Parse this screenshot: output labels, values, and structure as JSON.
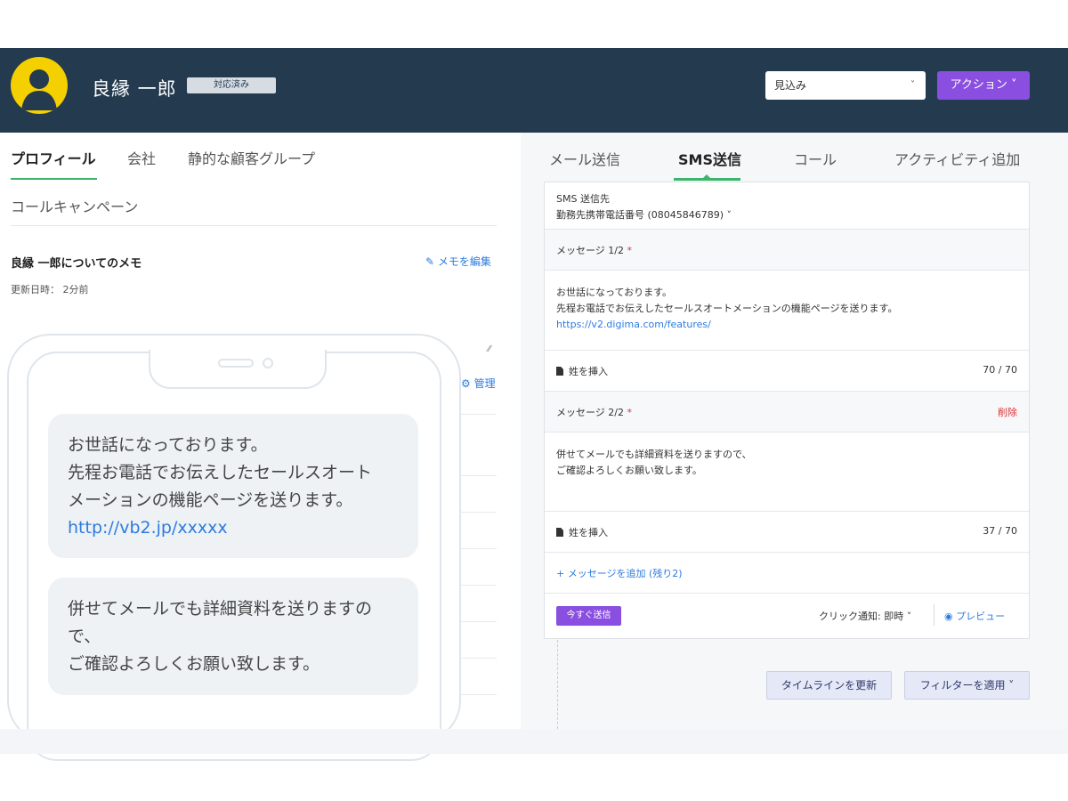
{
  "header": {
    "contact_name": "良縁 一郎",
    "status_badge": "対応済み",
    "stage_select": {
      "selected": "見込み",
      "chevron": "˅"
    },
    "action_button": "アクション ˅",
    "avatar_icon": "user-silhouette",
    "colors": {
      "background": "#243a4f",
      "avatar": "#f4d000",
      "action": "#8a4fe0"
    }
  },
  "left": {
    "tabs": [
      "プロフィール",
      "会社",
      "静的な顧客グループ"
    ],
    "tab_row2": "コールキャンペーン",
    "memo": {
      "title": "良縁 一郎についてのメモ",
      "edit_link": "✎ メモを編集",
      "updated": "更新日時： 2分前"
    },
    "manage_link": "⚙ 管理",
    "resize_mark": "⁄⁄"
  },
  "phone": {
    "bubble1": {
      "line1": "お世話になっております。",
      "line2": "先程お電話でお伝えしたセールスオート",
      "line3": "メーションの機能ページを送ります。",
      "link": "http://vb2.jp/xxxxx"
    },
    "bubble2": {
      "line1": "併せてメールでも詳細資料を送りますの",
      "line2": "で、",
      "line3": "ご確認よろしくお願い致します。"
    }
  },
  "right": {
    "tabs": [
      "メール送信",
      "SMS送信",
      "コール",
      "アクティビティ追加"
    ],
    "sms": {
      "to_label": "SMS 送信先",
      "to_value": "勤務先携帯電話番号 (08045846789)  ˅",
      "message1": {
        "label": "メッセージ 1/2",
        "required_mark": "*",
        "line1": "お世話になっております。",
        "line2": "先程お電話でお伝えしたセールスオートメーションの機能ページを送ります。",
        "link": "https://v2.digima.com/features/",
        "insert": "姓を挿入",
        "counter": "70 / 70"
      },
      "message2": {
        "label": "メッセージ 2/2",
        "required_mark": "*",
        "delete": "削除",
        "line1": "併せてメールでも詳細資料を送りますので、",
        "line2": "ご確認よろしくお願い致します。",
        "insert": "姓を挿入",
        "counter": "37 / 70"
      },
      "add_message": "+ メッセージを追加 (残り2)",
      "send_now": "今すぐ送信",
      "click_notify": "クリック通知: 即時  ˅",
      "preview": "◉ プレビュー"
    },
    "buttons": {
      "refresh_timeline": "タイムラインを更新",
      "apply_filter": "フィルターを適用 ˅"
    },
    "colors": {
      "tab_active": "#3cb46e",
      "link": "#2d7be0",
      "danger": "#d9343a"
    }
  }
}
